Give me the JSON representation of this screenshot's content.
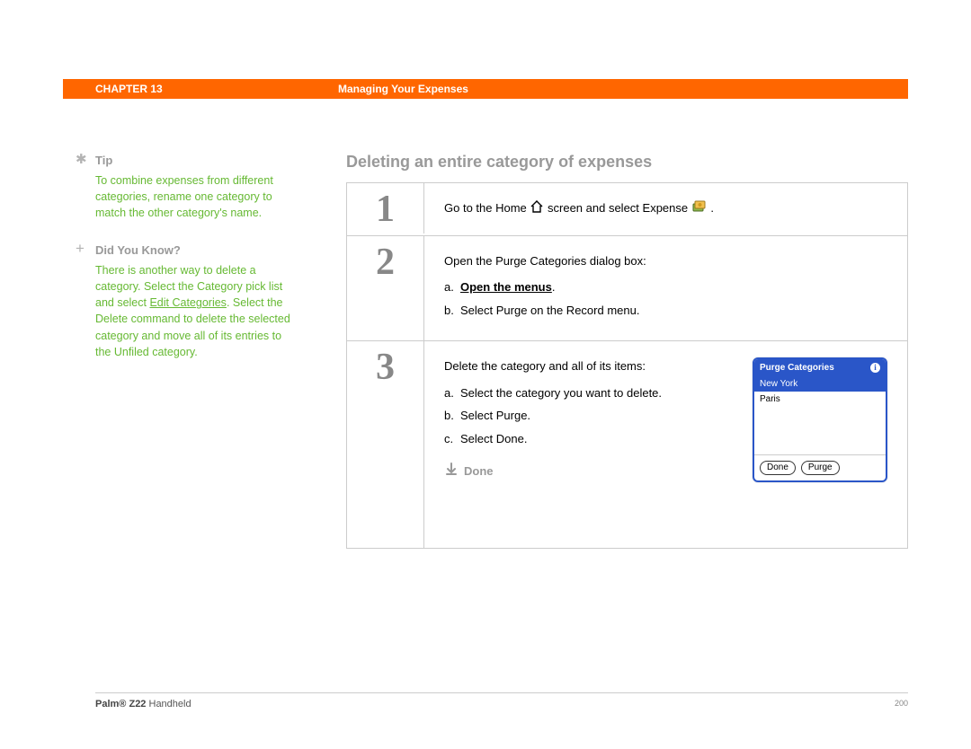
{
  "header": {
    "chapter": "CHAPTER 13",
    "title": "Managing Your Expenses"
  },
  "sidebar": {
    "tip": {
      "heading": "Tip",
      "body": "To combine expenses from different categories, rename one category to match the other category's name."
    },
    "dyk": {
      "heading": "Did You Know?",
      "pre": "There is another way to delete a category. Select the Category pick list and select ",
      "link": "Edit Categories",
      "post": ". Select the Delete command to delete the selected category and move all of its entries to the Unfiled category."
    }
  },
  "main": {
    "heading": "Deleting an entire category of expenses",
    "step1": {
      "num": "1",
      "text_a": "Go to the Home ",
      "text_b": " screen and select Expense ",
      "text_c": " ."
    },
    "step2": {
      "num": "2",
      "lead": "Open the Purge Categories dialog box:",
      "a_letter": "a.",
      "a_link": "Open the menus",
      "a_after": ".",
      "b_letter": "b.",
      "b_text": "Select Purge on the Record menu."
    },
    "step3": {
      "num": "3",
      "lead": "Delete the category and all of its items:",
      "a_letter": "a.",
      "a_text": "Select the category you want to delete.",
      "b_letter": "b.",
      "b_text": "Select Purge.",
      "c_letter": "c.",
      "c_text": "Select Done.",
      "done": "Done"
    },
    "dialog": {
      "title": "Purge Categories",
      "items": [
        "New York",
        "Paris"
      ],
      "selectedIndex": 0,
      "buttons": {
        "done": "Done",
        "purge": "Purge"
      }
    }
  },
  "footer": {
    "brand": "Palm®",
    "model": "Z22",
    "suffix": "Handheld",
    "page": "200"
  }
}
